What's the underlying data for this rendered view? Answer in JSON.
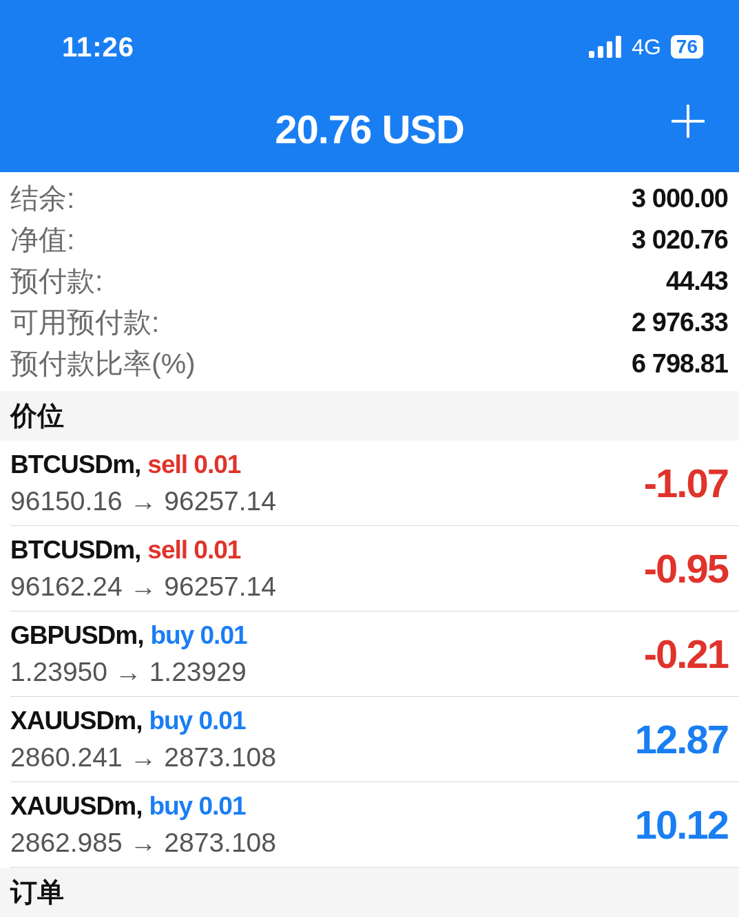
{
  "status_bar": {
    "time": "11:26",
    "network": "4G",
    "battery": "76"
  },
  "header": {
    "title": "20.76 USD"
  },
  "summary": [
    {
      "label": "结余:",
      "value": "3 000.00"
    },
    {
      "label": "净值:",
      "value": "3 020.76"
    },
    {
      "label": "预付款:",
      "value": "44.43"
    },
    {
      "label": "可用预付款:",
      "value": "2 976.33"
    },
    {
      "label": "预付款比率(%)",
      "value": "6 798.81"
    }
  ],
  "positions_section": {
    "title": "价位"
  },
  "positions": [
    {
      "symbol": "BTCUSDm,",
      "kind": "sell",
      "order": "sell 0.01",
      "prices": "96150.16 → 96257.14",
      "profit": "-1.07",
      "color": "#e0332b"
    },
    {
      "symbol": "BTCUSDm,",
      "kind": "sell",
      "order": "sell 0.01",
      "prices": "96162.24 → 96257.14",
      "profit": "-0.95",
      "color": "#e0332b"
    },
    {
      "symbol": "GBPUSDm,",
      "kind": "buy",
      "order": "buy 0.01",
      "prices": "1.23950 → 1.23929",
      "profit": "-0.21",
      "color": "#e0332b"
    },
    {
      "symbol": "XAUUSDm,",
      "kind": "buy",
      "order": "buy 0.01",
      "prices": "2860.241 → 2873.108",
      "profit": "12.87",
      "color": "#1a7ef3"
    },
    {
      "symbol": "XAUUSDm,",
      "kind": "buy",
      "order": "buy 0.01",
      "prices": "2862.985 → 2873.108",
      "profit": "10.12",
      "color": "#1a7ef3"
    }
  ],
  "orders_section": {
    "title": "订单"
  }
}
